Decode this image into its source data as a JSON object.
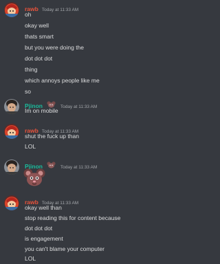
{
  "colors": {
    "background": "#36393f",
    "text": "#dcddde",
    "timestamp": "#a3a6aa",
    "rawb_name": "#e8533b",
    "pjinon_name": "#1abc9c"
  },
  "icons": {
    "badge": "mouse-badge-icon",
    "sticker": "mouse-sticker-icon"
  },
  "messages": [
    {
      "author": "rawb",
      "timestamp": "Today at 11:33 AM",
      "lines": [
        "oh",
        "okay well",
        "thats smart",
        "but you were doing the",
        "dot dot dot",
        "thing",
        "which annoys people like me",
        "so"
      ]
    },
    {
      "author": "Pjinon",
      "timestamp": "Today at 11:33 AM",
      "lines": [
        "Im on mobile"
      ]
    },
    {
      "author": "rawb",
      "timestamp": "Today at 11:33 AM",
      "lines": [
        "shut the fuck up than",
        "LOL"
      ]
    },
    {
      "author": "Pjinon",
      "timestamp": "Today at 11:33 AM",
      "lines": []
    },
    {
      "author": "rawb",
      "timestamp": "Today at 11:33 AM",
      "lines": [
        "okay well than",
        "stop reading this for content because",
        "dot dot dot",
        "is engagement",
        "you can't blame your computer",
        "LOL"
      ]
    }
  ]
}
